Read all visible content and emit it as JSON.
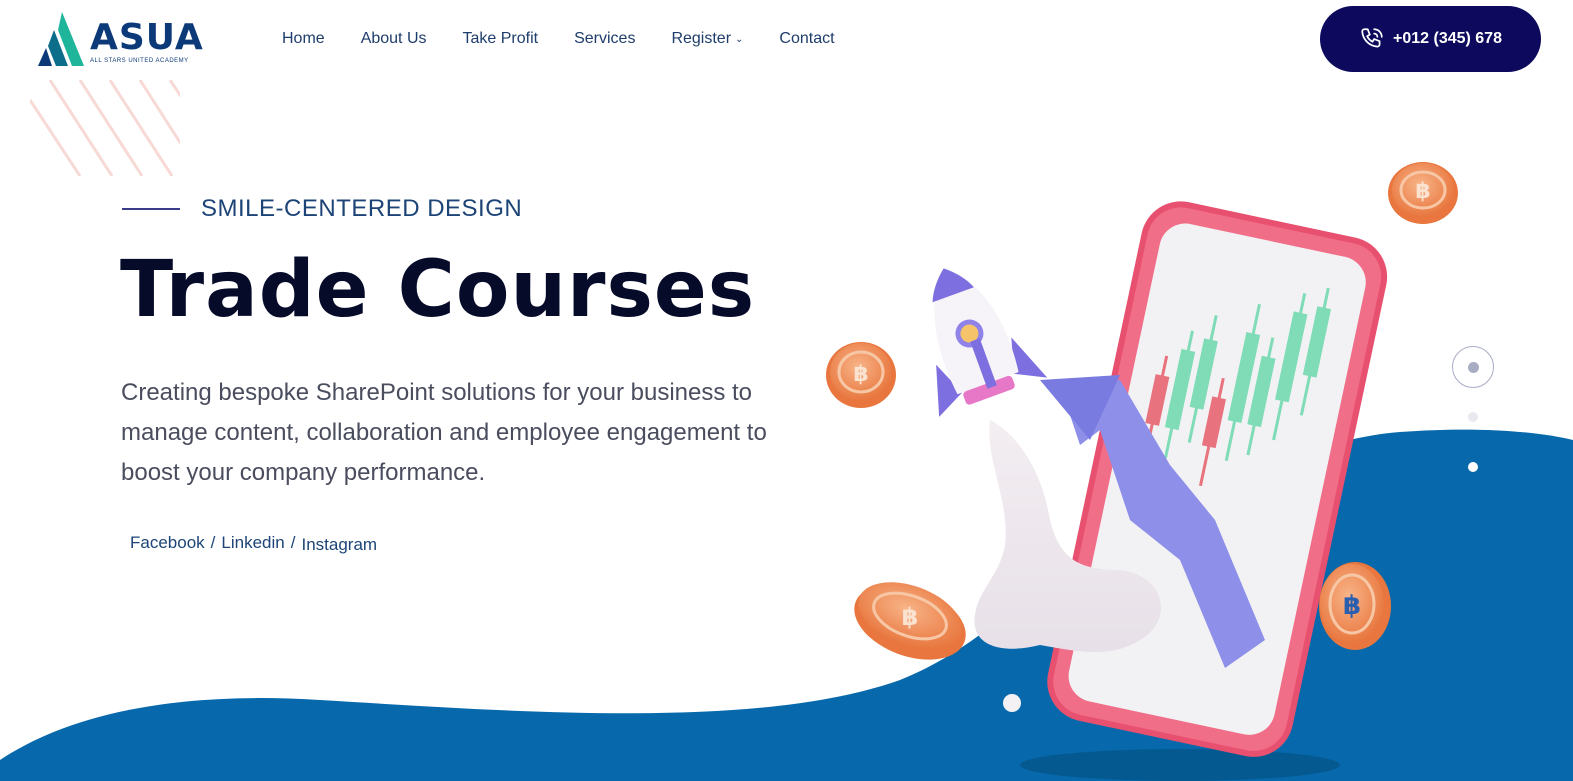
{
  "brand": {
    "name": "ASUA",
    "tagline": "ALL STARS UNITED ACADEMY",
    "colors": {
      "teal": "#1fb59b",
      "navy": "#0c3a78"
    }
  },
  "nav": {
    "items": [
      {
        "label": "Home"
      },
      {
        "label": "About Us"
      },
      {
        "label": "Take Profit"
      },
      {
        "label": "Services"
      },
      {
        "label": "Register",
        "has_dropdown": true
      },
      {
        "label": "Contact"
      }
    ]
  },
  "phone_button": {
    "label": "+012 (345) 678",
    "icon": "phone-icon",
    "color": "#0d0a5e"
  },
  "hero": {
    "eyebrow": "SMILE-CENTERED DESIGN",
    "title": "Trade Courses",
    "description": "Creating bespoke SharePoint solutions for your business to manage content, collaboration and employee engagement to boost your company performance.",
    "socials": [
      {
        "label": "Facebook"
      },
      {
        "label": "Linkedin"
      },
      {
        "label": "Instagram"
      }
    ],
    "separator": "/"
  },
  "slider": {
    "dots": 3,
    "active_index": 0
  },
  "colors": {
    "wave_blue": "#0769ab",
    "phone_pink": "#ee5d79",
    "candle_green": "#7fdcb7",
    "candle_red": "#e8737e",
    "arrow_purple": "#8d8fe8",
    "coin_orange": "#f0905e"
  }
}
